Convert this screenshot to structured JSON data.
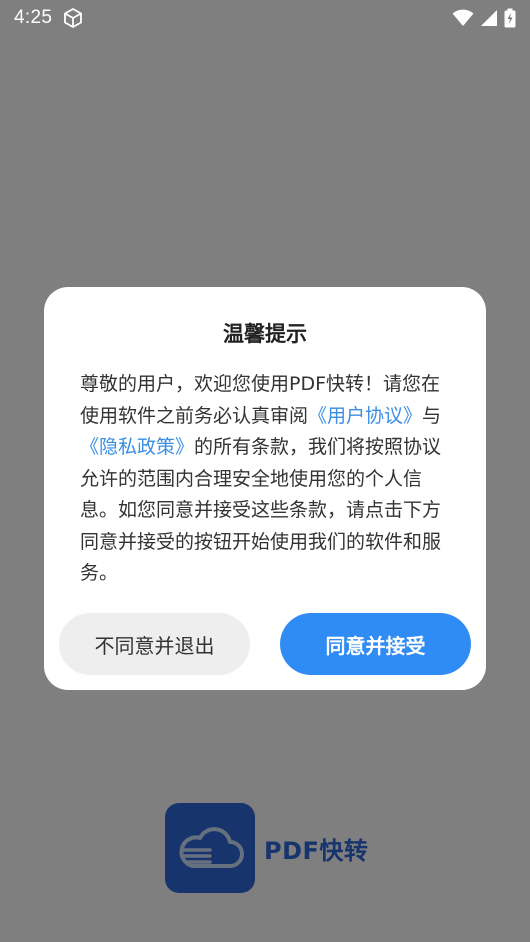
{
  "status_bar": {
    "time": "4:25",
    "icons": [
      "cube-icon",
      "wifi-icon",
      "cell-signal-icon",
      "battery-charging-icon"
    ]
  },
  "dialog": {
    "title": "温馨提示",
    "body": {
      "text_1": "尊敬的用户，欢迎您使用PDF快转！请您在使用软件之前务必认真审阅",
      "link_user_agreement": "《用户协议》",
      "text_2": "与",
      "link_privacy_policy": "《隐私政策》",
      "text_3": "的所有条款，我们将按照协议允许的范围内合理安全地使用您的个人信息。如您同意并接受这些条款，请点击下方同意并接受的按钮开始使用我们的软件和服务。"
    },
    "decline_label": "不同意并退出",
    "accept_label": "同意并接受"
  },
  "splash": {
    "app_name": "PDF快转",
    "logo_icon": "cloud-document-icon"
  },
  "colors": {
    "accent": "#2f8cf5",
    "link": "#3a8ee6",
    "brand": "#2e6ad8"
  }
}
